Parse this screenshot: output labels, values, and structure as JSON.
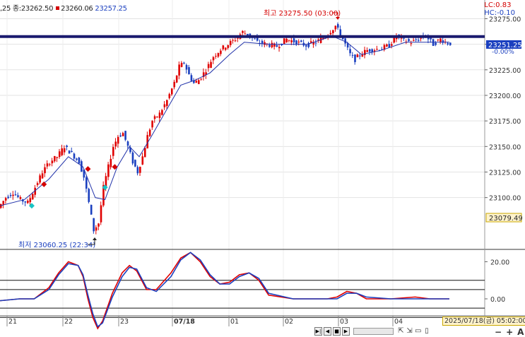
{
  "info_bar": {
    "left_text": ",25 종:23262.50",
    "sub_value": "23260.06",
    "sub_value2": "23257.25"
  },
  "lc_hc": {
    "lc": "LC:0.83",
    "hc": "HC:-0.10"
  },
  "price_labels": {
    "current": "23251.25",
    "current_pct": "-0.00%",
    "low_marker": "23079.49"
  },
  "annotations": {
    "high": "최고 23275.50 (03:00)",
    "low": "최저 23060.25 (22:34)"
  },
  "footer": {
    "date_time": "2025/07/18(금) 05:02:00",
    "zoom_buttons": [
      "⇱",
      "⇲",
      "▭",
      "▯"
    ]
  },
  "colors": {
    "up": "#e00000",
    "down": "#1a3fbf",
    "ma": "#2233aa",
    "level_line": "#1a1a6e"
  },
  "chart_data": [
    {
      "type": "candlestick",
      "x_labels": [
        "21",
        "22",
        "23",
        "07/18",
        "01",
        "02",
        "03",
        "04"
      ],
      "y_ticks": [
        23100.0,
        23125.0,
        23150.0,
        23175.0,
        23200.0,
        23225.0,
        23250.0,
        23275.0
      ],
      "ylim": [
        23050,
        23285
      ],
      "horizontal_level": 23257.5,
      "path_points": [
        {
          "x": 0,
          "y": 23090
        },
        {
          "x": 3,
          "y": 23100
        },
        {
          "x": 6,
          "y": 23105
        },
        {
          "x": 9,
          "y": 23098
        },
        {
          "x": 12,
          "y": 23095
        },
        {
          "x": 15,
          "y": 23110
        },
        {
          "x": 18,
          "y": 23125
        },
        {
          "x": 21,
          "y": 23135
        },
        {
          "x": 24,
          "y": 23140
        },
        {
          "x": 27,
          "y": 23150
        },
        {
          "x": 30,
          "y": 23143
        },
        {
          "x": 33,
          "y": 23135
        },
        {
          "x": 35,
          "y": 23120
        },
        {
          "x": 37,
          "y": 23095
        },
        {
          "x": 39,
          "y": 23068
        },
        {
          "x": 41,
          "y": 23075
        },
        {
          "x": 43,
          "y": 23110
        },
        {
          "x": 45,
          "y": 23130
        },
        {
          "x": 47,
          "y": 23150
        },
        {
          "x": 49,
          "y": 23160
        },
        {
          "x": 51,
          "y": 23163
        },
        {
          "x": 53,
          "y": 23150
        },
        {
          "x": 55,
          "y": 23135
        },
        {
          "x": 57,
          "y": 23125
        },
        {
          "x": 59,
          "y": 23140
        },
        {
          "x": 61,
          "y": 23160
        },
        {
          "x": 63,
          "y": 23175
        },
        {
          "x": 66,
          "y": 23182
        },
        {
          "x": 69,
          "y": 23195
        },
        {
          "x": 72,
          "y": 23212
        },
        {
          "x": 74,
          "y": 23228
        },
        {
          "x": 76,
          "y": 23232
        },
        {
          "x": 78,
          "y": 23220
        },
        {
          "x": 80,
          "y": 23212
        },
        {
          "x": 82,
          "y": 23215
        },
        {
          "x": 85,
          "y": 23225
        },
        {
          "x": 88,
          "y": 23238
        },
        {
          "x": 91,
          "y": 23245
        },
        {
          "x": 94,
          "y": 23250
        },
        {
          "x": 97,
          "y": 23255
        },
        {
          "x": 100,
          "y": 23262
        },
        {
          "x": 103,
          "y": 23258
        },
        {
          "x": 106,
          "y": 23252
        },
        {
          "x": 110,
          "y": 23250
        },
        {
          "x": 114,
          "y": 23248
        },
        {
          "x": 118,
          "y": 23255
        },
        {
          "x": 122,
          "y": 23252
        },
        {
          "x": 126,
          "y": 23249
        },
        {
          "x": 130,
          "y": 23252
        },
        {
          "x": 134,
          "y": 23258
        },
        {
          "x": 138,
          "y": 23268
        },
        {
          "x": 140,
          "y": 23260
        },
        {
          "x": 142,
          "y": 23250
        },
        {
          "x": 144,
          "y": 23240
        },
        {
          "x": 146,
          "y": 23235
        },
        {
          "x": 148,
          "y": 23240
        },
        {
          "x": 151,
          "y": 23244
        },
        {
          "x": 154,
          "y": 23245
        },
        {
          "x": 157,
          "y": 23246
        },
        {
          "x": 160,
          "y": 23249
        },
        {
          "x": 163,
          "y": 23258
        },
        {
          "x": 166,
          "y": 23254
        },
        {
          "x": 169,
          "y": 23252
        },
        {
          "x": 172,
          "y": 23255
        },
        {
          "x": 175,
          "y": 23258
        },
        {
          "x": 178,
          "y": 23250
        },
        {
          "x": 181,
          "y": 23255
        },
        {
          "x": 184,
          "y": 23251
        }
      ],
      "moving_average": [
        {
          "x": 0,
          "y": 23092
        },
        {
          "x": 10,
          "y": 23098
        },
        {
          "x": 20,
          "y": 23118
        },
        {
          "x": 28,
          "y": 23140
        },
        {
          "x": 34,
          "y": 23130
        },
        {
          "x": 39,
          "y": 23100
        },
        {
          "x": 43,
          "y": 23098
        },
        {
          "x": 48,
          "y": 23130
        },
        {
          "x": 53,
          "y": 23150
        },
        {
          "x": 57,
          "y": 23140
        },
        {
          "x": 62,
          "y": 23160
        },
        {
          "x": 68,
          "y": 23185
        },
        {
          "x": 74,
          "y": 23210
        },
        {
          "x": 80,
          "y": 23215
        },
        {
          "x": 86,
          "y": 23222
        },
        {
          "x": 94,
          "y": 23240
        },
        {
          "x": 100,
          "y": 23252
        },
        {
          "x": 110,
          "y": 23250
        },
        {
          "x": 126,
          "y": 23250
        },
        {
          "x": 136,
          "y": 23258
        },
        {
          "x": 142,
          "y": 23252
        },
        {
          "x": 148,
          "y": 23240
        },
        {
          "x": 156,
          "y": 23244
        },
        {
          "x": 166,
          "y": 23252
        },
        {
          "x": 184,
          "y": 23252
        }
      ],
      "signals": [
        {
          "x": 13,
          "y": 23092,
          "kind": "buy"
        },
        {
          "x": 18,
          "y": 23113,
          "kind": "sell"
        },
        {
          "x": 36,
          "y": 23128,
          "kind": "sell"
        },
        {
          "x": 43,
          "y": 23110,
          "kind": "buy"
        },
        {
          "x": 47,
          "y": 23130,
          "kind": "sell"
        }
      ]
    },
    {
      "type": "line",
      "name": "oscillator",
      "y_ticks": [
        20.0,
        0.0
      ],
      "ylim": [
        -8,
        24
      ],
      "reference_levels": [
        10,
        5,
        -5,
        -10
      ],
      "x": [
        0,
        8,
        14,
        20,
        24,
        28,
        32,
        34,
        36,
        38,
        40,
        42,
        46,
        50,
        53,
        56,
        60,
        64,
        70,
        74,
        78,
        82,
        86,
        90,
        94,
        98,
        102,
        106,
        110,
        120,
        128,
        134,
        138,
        142,
        146,
        150,
        160,
        170,
        176,
        184
      ],
      "series": [
        {
          "color": "#e00000",
          "values": [
            -1,
            0,
            0,
            6,
            14,
            20,
            18,
            12,
            0,
            -10,
            -16,
            -12,
            3,
            14,
            18,
            15,
            5,
            5,
            14,
            22,
            25,
            20,
            12,
            8,
            9,
            13,
            14,
            10,
            2,
            0,
            0,
            0,
            1,
            4,
            3,
            0,
            0,
            1,
            0,
            0
          ]
        },
        {
          "color": "#1a3fbf",
          "values": [
            -1,
            0,
            0,
            5,
            13,
            19,
            18,
            13,
            2,
            -8,
            -15,
            -13,
            1,
            12,
            17,
            16,
            6,
            4,
            12,
            21,
            25,
            21,
            13,
            8,
            8,
            12,
            14,
            11,
            3,
            0,
            0,
            0,
            0,
            3,
            3,
            1,
            0,
            0,
            0,
            0
          ]
        }
      ]
    }
  ]
}
